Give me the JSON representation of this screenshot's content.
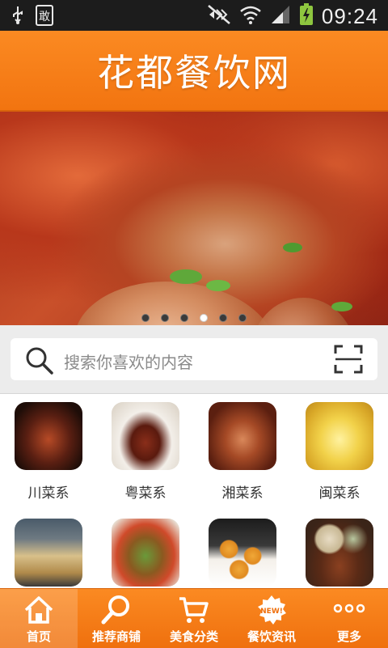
{
  "status_bar": {
    "time": "09:24",
    "icons": [
      "usb-icon",
      "debug-icon",
      "mute-icon",
      "wifi-icon",
      "signal-icon",
      "battery-charging-icon"
    ],
    "debug_glyph": "敢"
  },
  "header": {
    "title": "花都餐饮网",
    "accent_color": "#f27410"
  },
  "banner": {
    "slide_count": 6,
    "active_slide": 4
  },
  "search": {
    "placeholder": "搜索你喜欢的内容",
    "icons": [
      "search-icon",
      "scan-icon"
    ]
  },
  "categories": [
    {
      "label": "川菜系"
    },
    {
      "label": "粤菜系"
    },
    {
      "label": "湘菜系"
    },
    {
      "label": "闽菜系"
    },
    {
      "label": ""
    },
    {
      "label": ""
    },
    {
      "label": ""
    },
    {
      "label": ""
    }
  ],
  "tabbar": {
    "items": [
      {
        "label": "首页",
        "icon": "home-icon"
      },
      {
        "label": "推荐商铺",
        "icon": "magnifier-icon"
      },
      {
        "label": "美食分类",
        "icon": "cart-icon"
      },
      {
        "label": "餐饮资讯",
        "icon": "new-badge-icon",
        "badge": "NEW!"
      },
      {
        "label": "更多",
        "icon": "more-icon"
      }
    ],
    "active_index": 0
  }
}
